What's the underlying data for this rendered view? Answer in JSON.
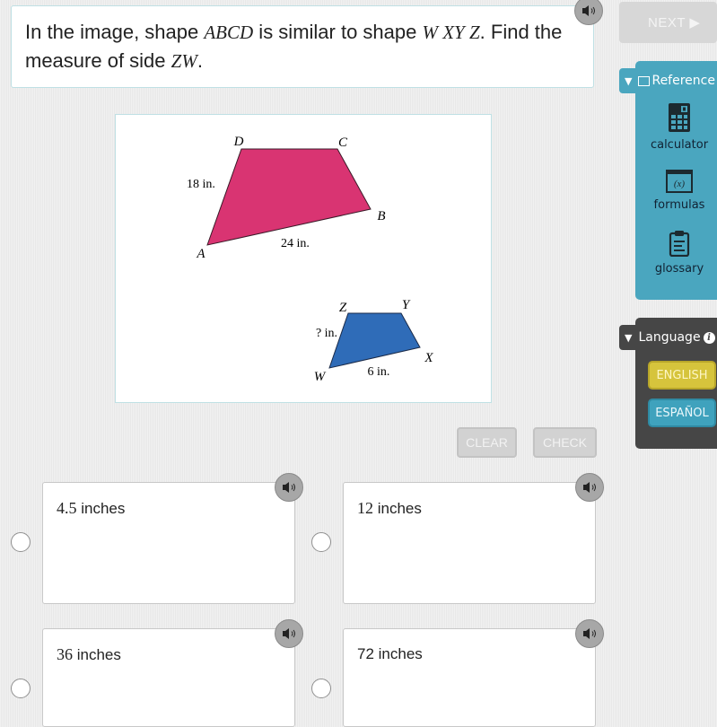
{
  "question": {
    "part1": "In the image, shape ",
    "shape1": "ABCD",
    "part2": " is similar to shape ",
    "shape2": "W XY Z",
    "part3": ". Find the measure of side ",
    "side": "ZW",
    "part4": "."
  },
  "nav": {
    "next_label": "NEXT ▶"
  },
  "reference": {
    "tab_label": "Reference",
    "items": [
      {
        "label": "calculator",
        "icon": "calculator-icon"
      },
      {
        "label": "formulas",
        "icon": "formulas-icon"
      },
      {
        "label": "glossary",
        "icon": "clipboard-icon"
      }
    ],
    "formula_glyph": "(x)"
  },
  "language": {
    "tab_label": "Language",
    "info_glyph": "i",
    "options": [
      "ENGLISH",
      "ESPAÑOL"
    ]
  },
  "figure": {
    "large_shape": {
      "vertices": [
        "A",
        "B",
        "C",
        "D"
      ],
      "side_DA": "18 in.",
      "side_AB": "24 in.",
      "color": "#d93472"
    },
    "small_shape": {
      "vertices": [
        "W",
        "X",
        "Y",
        "Z"
      ],
      "side_ZW": "? in.",
      "side_WX": "6 in.",
      "color": "#2f6cb8"
    }
  },
  "actions": {
    "clear_label": "CLEAR",
    "check_label": "CHECK"
  },
  "choices": [
    {
      "number": "4.5",
      "unit": " inches"
    },
    {
      "number": "12",
      "unit": " inches"
    },
    {
      "number": "36",
      "unit": " inches"
    },
    {
      "number": "72",
      "unit": " inches"
    }
  ]
}
